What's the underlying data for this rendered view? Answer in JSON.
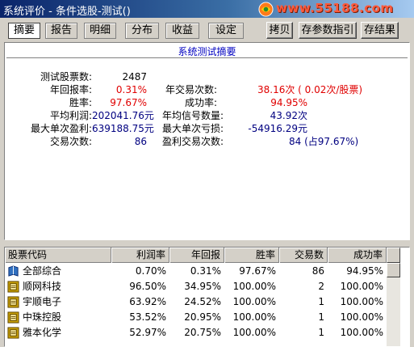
{
  "window": {
    "title": "系统评价 - 条件选股-测试()",
    "watermark": "www.55188.com"
  },
  "tabs": [
    {
      "label": "摘要",
      "active": true
    },
    {
      "label": "报告",
      "active": false
    },
    {
      "label": "明细",
      "active": false
    },
    {
      "label": "分布",
      "active": false
    },
    {
      "label": "收益",
      "active": false
    },
    {
      "label": "设定",
      "active": false
    }
  ],
  "buttons": {
    "copy": "拷贝",
    "save_params": "存参数指引",
    "save_results": "存结果"
  },
  "summary": {
    "title": "系统测试摘要",
    "left": [
      {
        "label": "测试股票数:",
        "value": "2487",
        "color": "blue"
      },
      {
        "label": "年回报率:",
        "value": "0.31%",
        "color": "red"
      },
      {
        "label": "胜率:",
        "value": "97.67%",
        "color": "red"
      },
      {
        "label": "平均利润:",
        "value": "202041.76元",
        "color": "blue"
      },
      {
        "label": "最大单次盈利:",
        "value": "639188.75元",
        "color": "blue"
      },
      {
        "label": "交易次数:",
        "value": "86",
        "color": "blue"
      }
    ],
    "right": [
      {
        "label": "年交易次数:",
        "value": "38.16次 ( 0.02次/股票)",
        "color": "red"
      },
      {
        "label": "成功率:",
        "value": "94.95%",
        "color": "red"
      },
      {
        "label": "年均信号数量:",
        "value": "43.92次",
        "color": "blue"
      },
      {
        "label": "最大单次亏损:",
        "value": "-54916.29元",
        "color": "blue"
      },
      {
        "label": "盈利交易次数:",
        "value": "84 (占97.67%)",
        "color": "blue"
      }
    ]
  },
  "table": {
    "headers": [
      "股票代码",
      "利润率",
      "年回报",
      "胜率",
      "交易数",
      "成功率"
    ],
    "rows": [
      {
        "icon": "book-icon",
        "name": "全部综合",
        "profit": "0.70%",
        "annual": "0.31%",
        "win": "97.67%",
        "trades": "86",
        "success": "94.95%"
      },
      {
        "icon": "stock-icon",
        "name": "顺网科技",
        "profit": "96.50%",
        "annual": "34.95%",
        "win": "100.00%",
        "trades": "2",
        "success": "100.00%"
      },
      {
        "icon": "stock-icon",
        "name": "宇顺电子",
        "profit": "63.92%",
        "annual": "24.52%",
        "win": "100.00%",
        "trades": "1",
        "success": "100.00%"
      },
      {
        "icon": "stock-icon",
        "name": "中珠控股",
        "profit": "53.52%",
        "annual": "20.95%",
        "win": "100.00%",
        "trades": "1",
        "success": "100.00%"
      },
      {
        "icon": "stock-icon",
        "name": "雅本化学",
        "profit": "52.97%",
        "annual": "20.75%",
        "win": "100.00%",
        "trades": "1",
        "success": "100.00%"
      }
    ]
  },
  "colors": {
    "red": "#e00000",
    "blue": "#000080",
    "panel_title": "#0000c0"
  }
}
